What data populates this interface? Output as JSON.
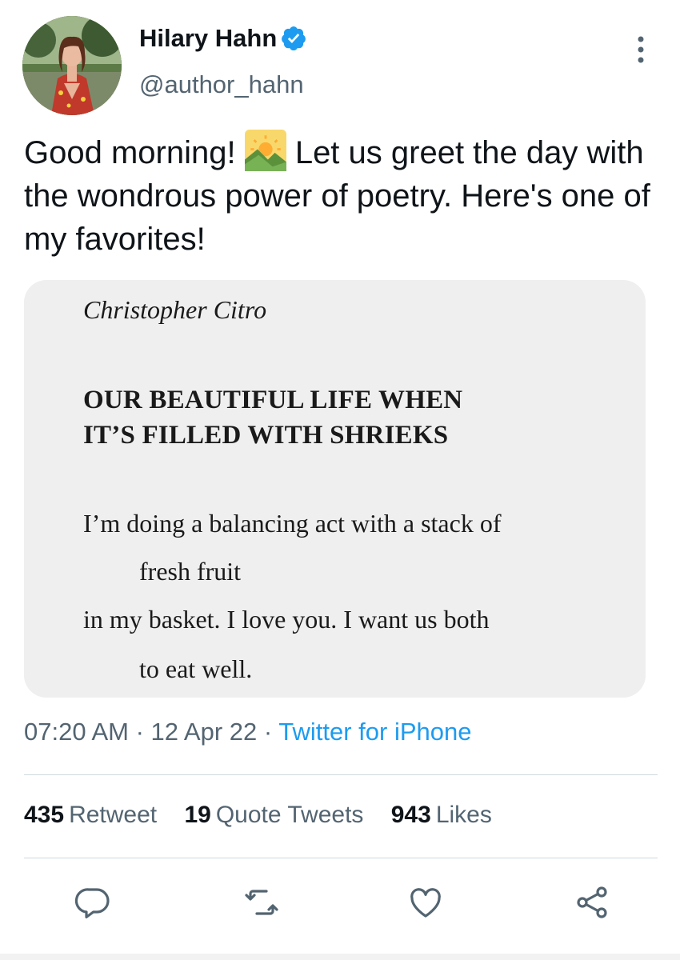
{
  "author": {
    "name": "Hilary Hahn",
    "handle": "@author_hahn",
    "verified": true
  },
  "tweet": {
    "text_before_emoji": "Good morning! ",
    "emoji": "sunrise-over-mountains",
    "text_after_emoji": " Let us greet the day with the wondrous power of poetry. Here's one of my favorites!"
  },
  "attachment": {
    "poet": "Christopher Citro",
    "title_line1": "OUR BEAUTIFUL LIFE WHEN",
    "title_line2": "IT’S FILLED WITH SHRIEKS",
    "lines": [
      "I’m doing a balancing act with a stack of",
      "fresh fruit",
      "in my basket. I love you. I want us both",
      "to eat well."
    ]
  },
  "meta": {
    "time": "07:20 AM",
    "sep1": " · ",
    "date": "12 Apr 22",
    "sep2": " · ",
    "source": "Twitter for iPhone"
  },
  "stats": {
    "retweets": "435",
    "retweets_label": "Retweet",
    "quotes": "19",
    "quotes_label": "Quote Tweets",
    "likes": "943",
    "likes_label": "Likes"
  },
  "actions": [
    "reply-icon",
    "retweet-icon",
    "like-icon",
    "share-icon"
  ],
  "colors": {
    "accent": "#1d9bf0",
    "text": "#0f1419",
    "secondary": "#536471",
    "divider": "#cfd9de"
  }
}
